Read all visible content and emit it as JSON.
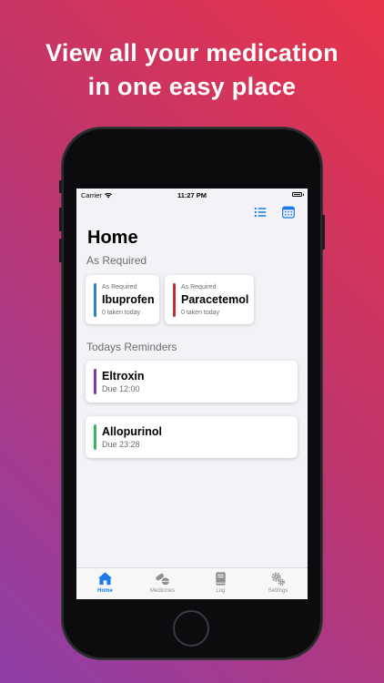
{
  "headline": {
    "line1": "View all your medication",
    "line2": "in one easy place"
  },
  "status_bar": {
    "carrier": "Carrier",
    "time": "11:27 PM"
  },
  "nav": {
    "icons": [
      "list-icon",
      "calendar-icon"
    ],
    "accent": "#1a7ae8"
  },
  "page": {
    "title": "Home",
    "as_required_title": "As Required",
    "reminders_title": "Todays Reminders"
  },
  "as_required": [
    {
      "tag": "As Required",
      "name": "Ibuprofen",
      "taken": "0 taken today",
      "color": "#2a7fd6"
    },
    {
      "tag": "As Required",
      "name": "Paracetemol",
      "taken": "0 taken today",
      "color": "#b8322d"
    }
  ],
  "reminders": [
    {
      "name": "Eltroxin",
      "due": "Due 12:00",
      "color": "#7b3fa8"
    },
    {
      "name": "Allopurinol",
      "due": "Due 23:28",
      "color": "#34b95c"
    }
  ],
  "tabbar": {
    "tabs": [
      {
        "label": "Home",
        "icon": "house-icon",
        "active": true
      },
      {
        "label": "Medicines",
        "icon": "pills-icon",
        "active": false
      },
      {
        "label": "Log",
        "icon": "book-icon",
        "active": false
      },
      {
        "label": "Settings",
        "icon": "gears-icon",
        "active": false
      }
    ]
  }
}
